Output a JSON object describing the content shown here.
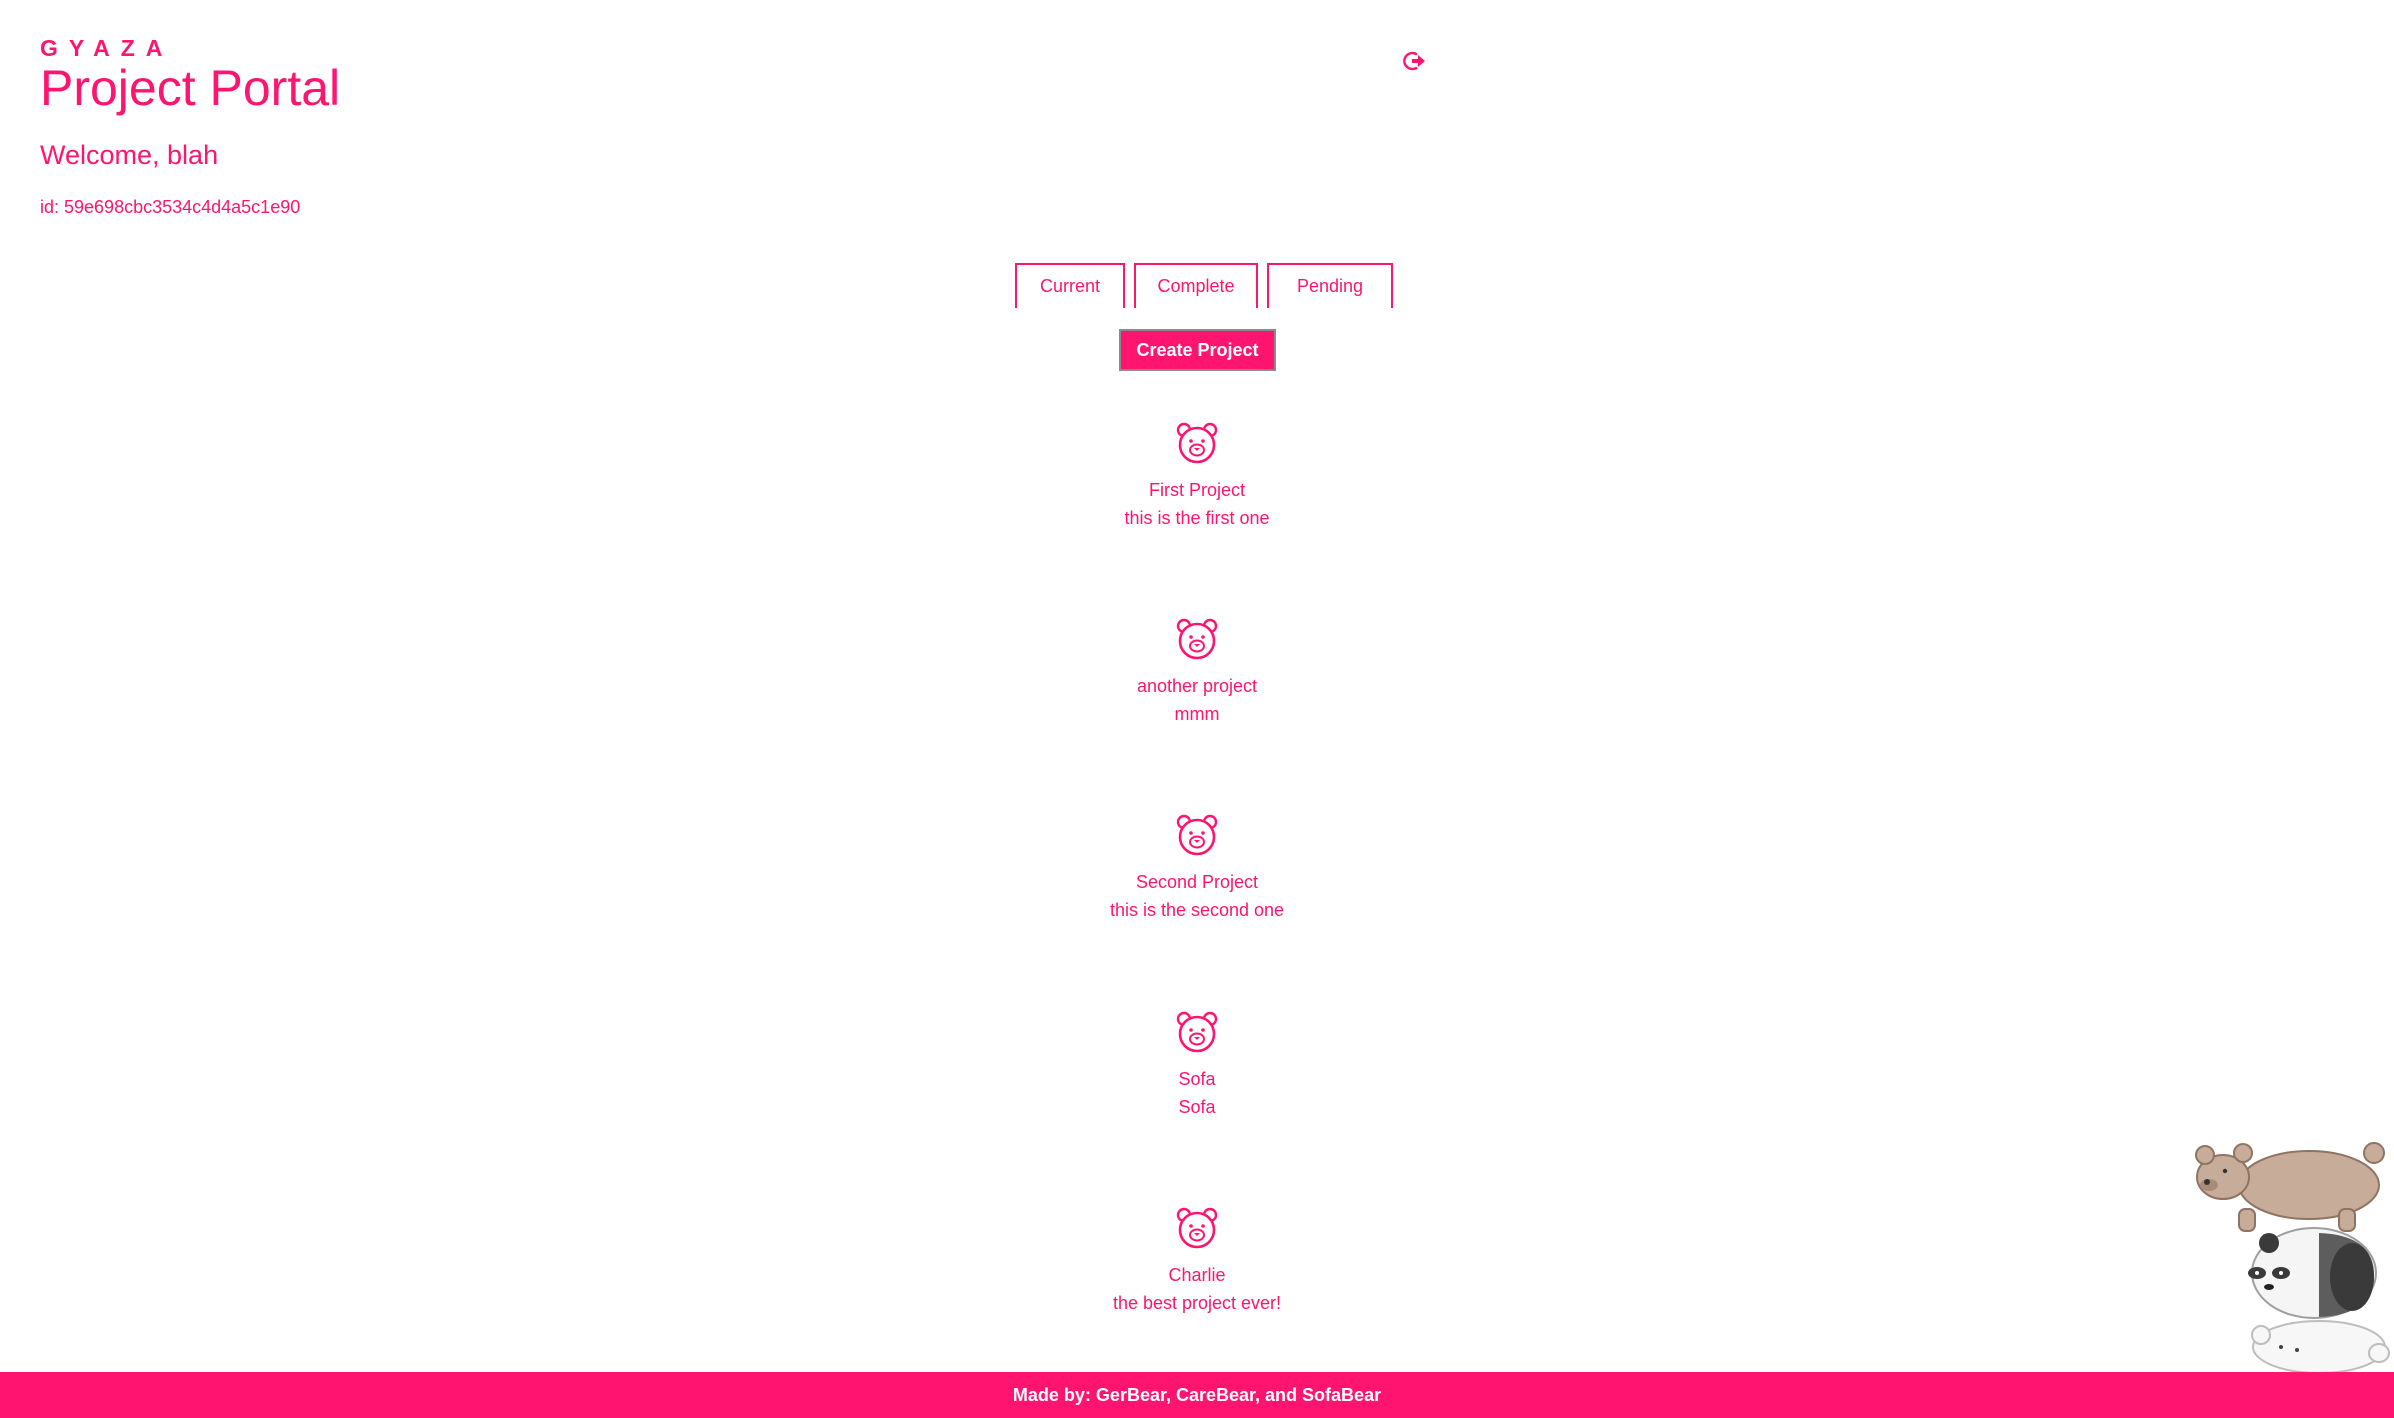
{
  "header": {
    "brand": "GYAZA",
    "title": "Project Portal",
    "welcome": "Welcome, blah",
    "user_id": "id: 59e698cbc3534c4d4a5c1e90",
    "logout_icon": "logout-icon"
  },
  "tabs": [
    {
      "label": "Current"
    },
    {
      "label": "Complete"
    },
    {
      "label": "Pending"
    }
  ],
  "create_button": {
    "label": "Create Project"
  },
  "projects": [
    {
      "name": "First Project",
      "description": "this is the first one",
      "icon": "bear-icon"
    },
    {
      "name": "another project",
      "description": "mmm",
      "icon": "bear-icon"
    },
    {
      "name": "Second Project",
      "description": "this is the second one",
      "icon": "bear-icon"
    },
    {
      "name": "Sofa",
      "description": "Sofa",
      "icon": "bear-icon"
    },
    {
      "name": "Charlie",
      "description": "the best project ever!",
      "icon": "bear-icon"
    }
  ],
  "footer": {
    "text": "Made by: GerBear, CareBear, and SofaBear"
  },
  "colors": {
    "accent": "#ff1470",
    "background": "#ffffff",
    "button_border": "#8a8a8a"
  }
}
